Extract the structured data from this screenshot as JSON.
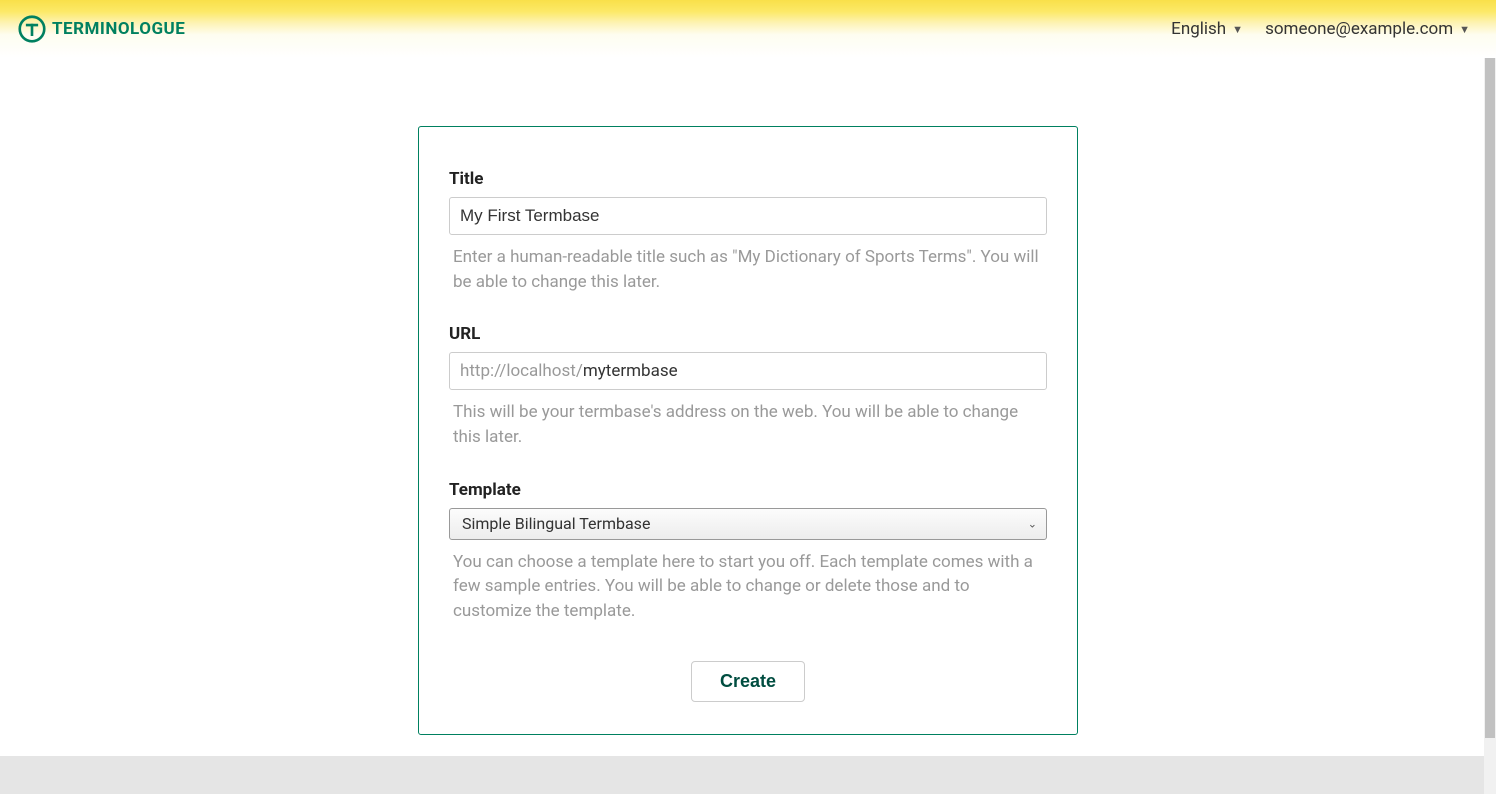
{
  "header": {
    "brand": "TERMINOLOGUE",
    "language": "English",
    "user": "someone@example.com"
  },
  "form": {
    "title": {
      "label": "Title",
      "value": "My First Termbase",
      "help": "Enter a human-readable title such as \"My Dictionary of Sports Terms\". You will be able to change this later."
    },
    "url": {
      "label": "URL",
      "prefix": "http://localhost/",
      "value": "mytermbase",
      "help": "This will be your termbase's address on the web. You will be able to change this later."
    },
    "template": {
      "label": "Template",
      "value": "Simple Bilingual Termbase",
      "help": "You can choose a template here to start you off. Each template comes with a few sample entries. You will be able to change or delete those and to customize the template."
    },
    "submit": "Create"
  }
}
